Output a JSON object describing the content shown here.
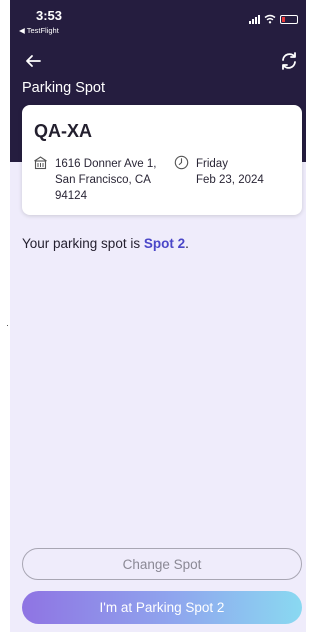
{
  "status_bar": {
    "time": "3:53",
    "back_app": "◀ TestFlight"
  },
  "header": {
    "title": "Parking Spot"
  },
  "card": {
    "spot_code": "QA-XA",
    "address": {
      "line1": "1616 Donner Ave 1,",
      "line2": "San Francisco, CA",
      "line3": "94124"
    },
    "date": {
      "weekday": "Friday",
      "date": "Feb 23, 2024"
    }
  },
  "message": {
    "prefix": "Your parking spot is ",
    "spot": "Spot 2",
    "suffix": "."
  },
  "buttons": {
    "change_spot": "Change Spot",
    "arrived": "I'm at Parking Spot 2"
  },
  "colors": {
    "header_bg": "#251d3f",
    "page_bg": "#efecfb",
    "accent": "#4a46c8"
  },
  "icons": [
    "back-arrow-icon",
    "refresh-icon",
    "building-icon",
    "clock-icon",
    "signal-icon",
    "wifi-icon",
    "battery-icon"
  ]
}
